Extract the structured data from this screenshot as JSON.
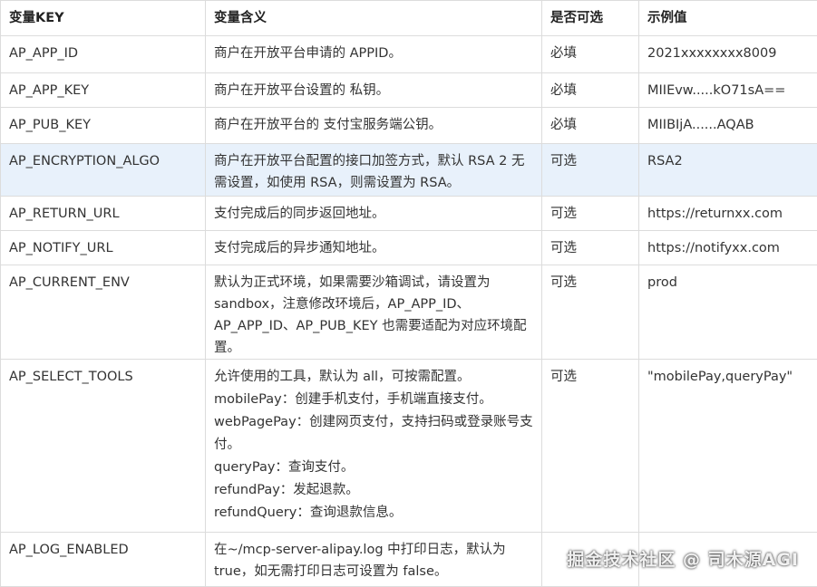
{
  "headers": [
    "变量KEY",
    "变量含义",
    "是否可选",
    "示例值"
  ],
  "rows": [
    {
      "key": "AP_APP_ID",
      "desc": "商户在开放平台申请的 APPID。",
      "optional": "必填",
      "example": "2021xxxxxxxx8009"
    },
    {
      "key": "AP_APP_KEY",
      "desc": "商户在开放平台设置的 私钥。",
      "optional": "必填",
      "example": "MIIEvw.....kO71sA=="
    },
    {
      "key": "AP_PUB_KEY",
      "desc": "商户在开放平台的 支付宝服务端公钥。",
      "optional": "必填",
      "example": "MIIBIjA......AQAB"
    },
    {
      "key": "AP_ENCRYPTION_ALGO",
      "desc": "商户在开放平台配置的接口加签方式，默认 RSA 2 无需设置，如使用 RSA，则需设置为 RSA。",
      "optional": "可选",
      "example": "RSA2"
    },
    {
      "key": "AP_RETURN_URL",
      "desc": "支付完成后的同步返回地址。",
      "optional": "可选",
      "example": "https://returnxx.com"
    },
    {
      "key": "AP_NOTIFY_URL",
      "desc": "支付完成后的异步通知地址。",
      "optional": "可选",
      "example": "https://notifyxx.com"
    },
    {
      "key": "AP_CURRENT_ENV",
      "desc": "默认为正式环境，如果需要沙箱调试，请设置为 sandbox，注意修改环境后，AP_APP_ID、AP_APP_ID、AP_PUB_KEY 也需要适配为对应环境配置。",
      "optional": "可选",
      "example": "prod"
    },
    {
      "key": "AP_SELECT_TOOLS",
      "desc_lines": [
        "允许使用的工具，默认为 all，可按需配置。",
        "mobilePay：创建手机支付，手机端直接支付。",
        "webPagePay：创建网页支付，支持扫码或登录账号支付。",
        "queryPay：查询支付。",
        "refundPay：发起退款。",
        "refundQuery：查询退款信息。"
      ],
      "optional": "可选",
      "example": "\"mobilePay,queryPay\""
    },
    {
      "key": "AP_LOG_ENABLED",
      "desc": "在~/mcp-server-alipay.log 中打印日志，默认为 true，如无需打印日志可设置为 false。",
      "optional": "",
      "example": ""
    }
  ],
  "watermark": "掘金技术社区 @ 司木源AGI"
}
